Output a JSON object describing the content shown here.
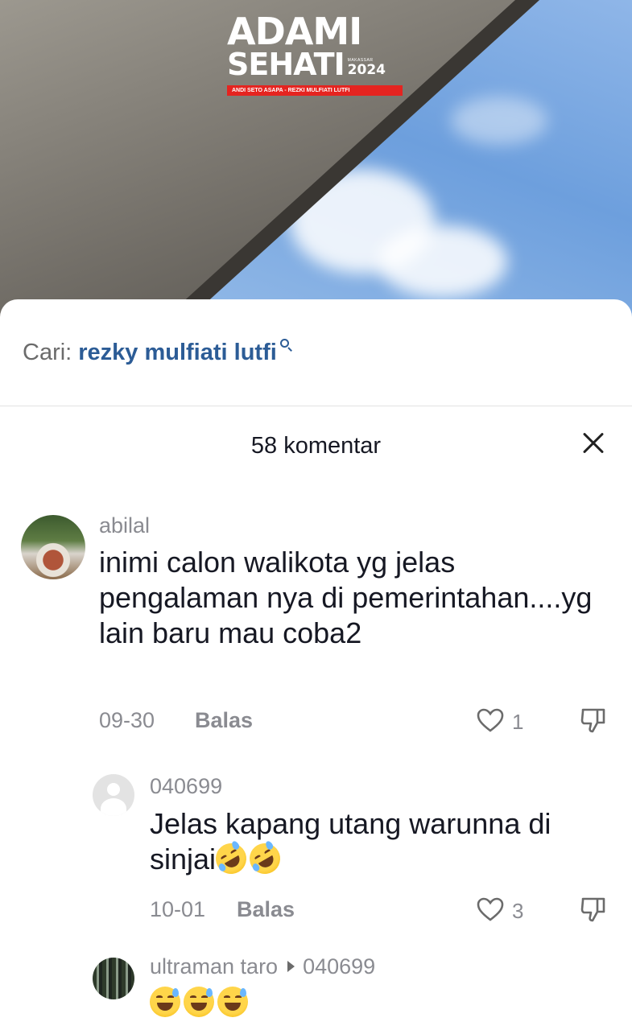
{
  "video": {
    "logo_line1": "ADAMI",
    "logo_line2": "SEHATI",
    "logo_city": "MAKASSAR",
    "logo_year": "2024",
    "logo_tagline": "ANDI SETO ASAPA - REZKI MULFIATI LUTFI"
  },
  "search": {
    "prefix": "Cari:",
    "term": "rezky mulfiati lutfi",
    "icon": "search-icon"
  },
  "header": {
    "comment_count_label": "58 komentar",
    "close_icon": "close-icon"
  },
  "comments": [
    {
      "username": "abilal",
      "text": "inimi calon walikota yg jelas pengalaman nya di pemerintahan....yg lain baru mau coba2",
      "date": "09-30",
      "reply_label": "Balas",
      "likes": "1"
    },
    {
      "username": "040699",
      "text": "Jelas kapang utang warunna di sinjai",
      "emojis": [
        "rofl",
        "rofl"
      ],
      "date": "10-01",
      "reply_label": "Balas",
      "likes": "3"
    },
    {
      "username": "ultraman taro",
      "reply_to": "040699",
      "emojis": [
        "sweat-smile",
        "sweat-smile",
        "sweat-smile"
      ]
    }
  ],
  "colors": {
    "search_term": "#2c5c96",
    "muted_text": "#8a8b91",
    "primary_text": "#161823",
    "logo_bar": "#e52420"
  }
}
